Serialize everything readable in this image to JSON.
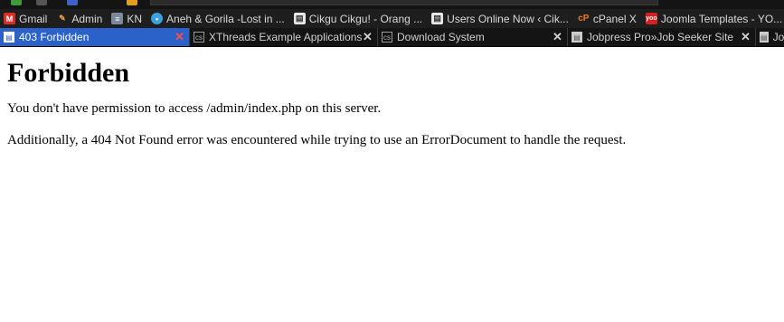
{
  "bookmarks": [
    {
      "label": "Gmail",
      "icon": "gmail-icon"
    },
    {
      "label": "Admin",
      "icon": "admin-icon"
    },
    {
      "label": "KN",
      "icon": "kn-icon"
    },
    {
      "label": "Aneh & Gorila -Lost in ...",
      "icon": "chat-icon"
    },
    {
      "label": "Cikgu Cikgu! - Orang ...",
      "icon": "page-icon"
    },
    {
      "label": "Users Online Now ‹ Cik...",
      "icon": "page-icon"
    },
    {
      "label": "cPanel X",
      "icon": "cpanel-icon"
    },
    {
      "label": "Joomla Templates - YO...",
      "icon": "yoo-icon"
    },
    {
      "label": "",
      "icon": "bar-chart-icon"
    }
  ],
  "tabs": [
    {
      "label": "403 Forbidden",
      "active": true
    },
    {
      "label": "XThreads Example Applications",
      "active": false
    },
    {
      "label": "Download System",
      "active": false
    },
    {
      "label": "Jobpress Pro»Job Seeker Site",
      "active": false
    },
    {
      "label": "Jo",
      "active": false
    }
  ],
  "page": {
    "heading": "Forbidden",
    "message": "You don't have permission to access /admin/index.php on this server.",
    "note": "Additionally, a 404 Not Found error was encountered while trying to use an ErrorDocument to handle the request."
  },
  "colors": {
    "active_tab": "#2a62c9",
    "toolbar_bg": "#1e1e1e",
    "tab_bar_bg": "#141414",
    "close_active": "#ff4c4c"
  }
}
